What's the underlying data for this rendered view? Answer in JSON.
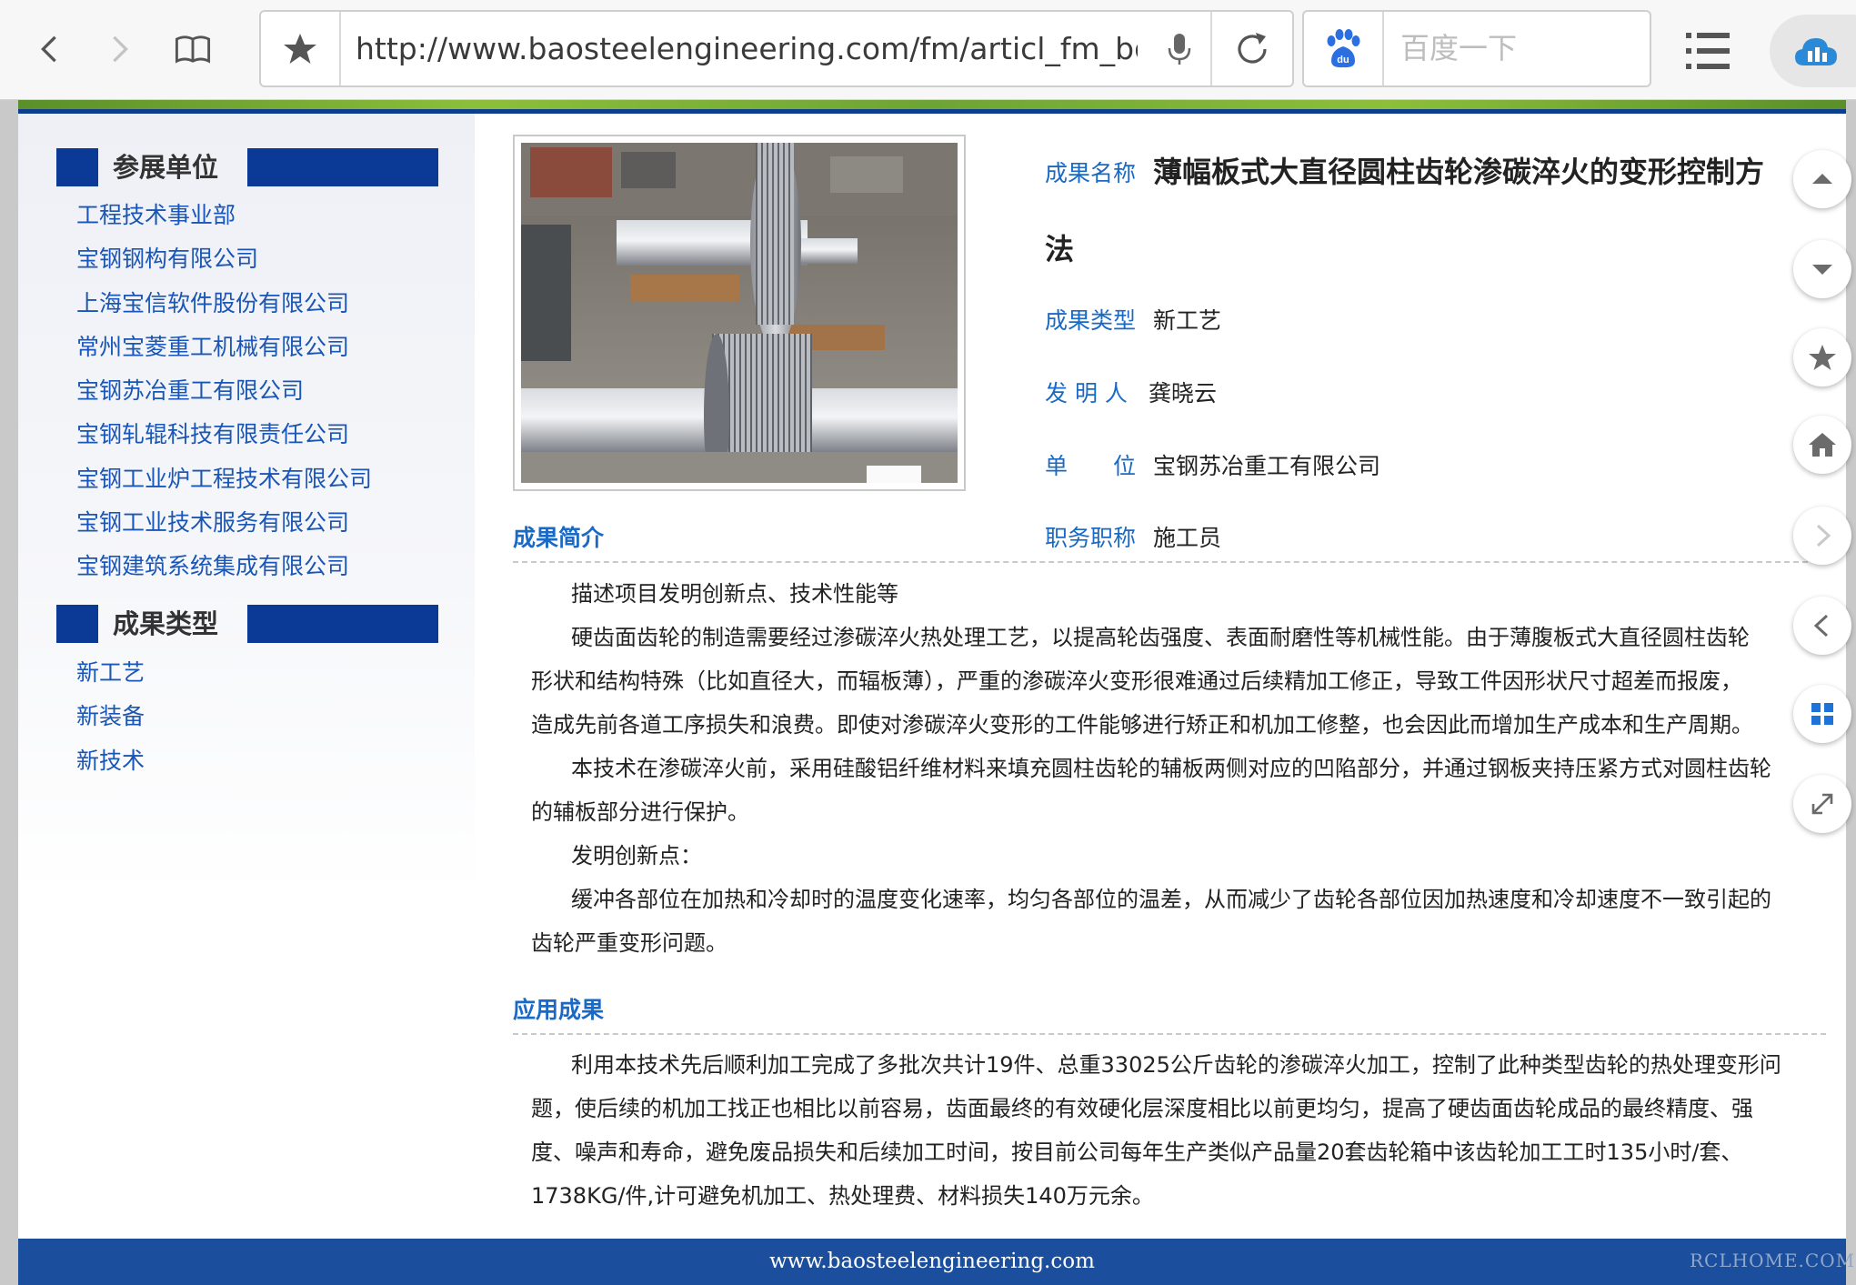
{
  "browser": {
    "url": "http://www.baosteelengineering.com/fm/articl_fm_bgs…",
    "search_placeholder": "百度一下",
    "icons": [
      "back-icon",
      "forward-icon",
      "bookmarks-icon",
      "star-icon",
      "microphone-icon",
      "reload-icon",
      "baidu-logo-icon",
      "menu-icon",
      "cloud-icon"
    ]
  },
  "sidebar": {
    "sections": [
      {
        "title": "参展单位",
        "items": [
          "工程技术事业部",
          "宝钢钢构有限公司",
          "上海宝信软件股份有限公司",
          "常州宝菱重工机械有限公司",
          "宝钢苏冶重工有限公司",
          "宝钢轧辊科技有限责任公司",
          "宝钢工业炉工程技术有限公司",
          "宝钢工业技术服务有限公司",
          "宝钢建筑系统集成有限公司"
        ]
      },
      {
        "title": "成果类型",
        "items": [
          "新工艺",
          "新装备",
          "新技术"
        ]
      }
    ]
  },
  "article": {
    "fields": {
      "name_label": "成果名称",
      "name_line1": "薄幅板式大直径圆柱齿轮渗碳淬火的变形控制方",
      "name_line2": "法",
      "type_label": "成果类型",
      "type_value": "新工艺",
      "inventor_label": "发 明 人",
      "inventor_value": "龚晓云",
      "unit_label_a": "单",
      "unit_label_b": "位",
      "unit_value": "宝钢苏冶重工有限公司",
      "title_label": "职务职称",
      "title_value": "施工员"
    },
    "summary": {
      "heading": "成果简介",
      "p1": "描述项目发明创新点、技术性能等",
      "p2_l1": "硬齿面齿轮的制造需要经过渗碳淬火热处理工艺，以提高轮齿强度、表面耐磨性等机械性能。由于薄腹板式大直径圆柱齿轮",
      "p2_l2": "形状和结构特殊（比如直径大，而辐板薄），严重的渗碳淬火变形很难通过后续精加工修正，导致工件因形状尺寸超差而报废，",
      "p2_l3": "造成先前各道工序损失和浪费。即使对渗碳淬火变形的工件能够进行矫正和机加工修整，也会因此而增加生产成本和生产周期。",
      "p3_l1": "本技术在渗碳淬火前，采用硅酸铝纤维材料来填充圆柱齿轮的辅板两侧对应的凹陷部分，并通过钢板夹持压紧方式对圆柱齿轮",
      "p3_l2": "的辅板部分进行保护。",
      "p4": "发明创新点：",
      "p5_l1": "缓冲各部位在加热和冷却时的温度变化速率，均匀各部位的温差，从而减少了齿轮各部位因加热速度和冷却速度不一致引起的",
      "p5_l2": "齿轮严重变形问题。"
    },
    "application": {
      "heading": "应用成果",
      "l1": "利用本技术先后顺利加工完成了多批次共计19件、总重33025公斤齿轮的渗碳淬火加工，控制了此种类型齿轮的热处理变形问",
      "l2": "题，使后续的机加工找正也相比以前容易，齿面最终的有效硬化层深度相比以前更均匀，提高了硬齿面齿轮成品的最终精度、强",
      "l3": "度、噪声和寿命，避免废品损失和后续加工时间，按目前公司每年生产类似产品量20套齿轮箱中该齿轮加工工时135小时/套、",
      "l4": "1738KG/件,计可避免机加工、热处理费、材料损失140万元余。"
    }
  },
  "footer": {
    "site": "www.baosteelengineering.com",
    "watermark": "RCLHOME.COM"
  },
  "float_buttons": [
    "scroll-up-icon",
    "scroll-down-icon",
    "favorite-icon",
    "home-icon",
    "forward-page-icon",
    "back-page-icon",
    "grid-icon",
    "fullscreen-icon"
  ],
  "colors": {
    "link_blue": "#1a56b5",
    "label_blue": "#1a69c4",
    "header_block": "#0b3a96",
    "footer_blue": "#1b4e9c",
    "green_strip": "#8cbf3b"
  }
}
